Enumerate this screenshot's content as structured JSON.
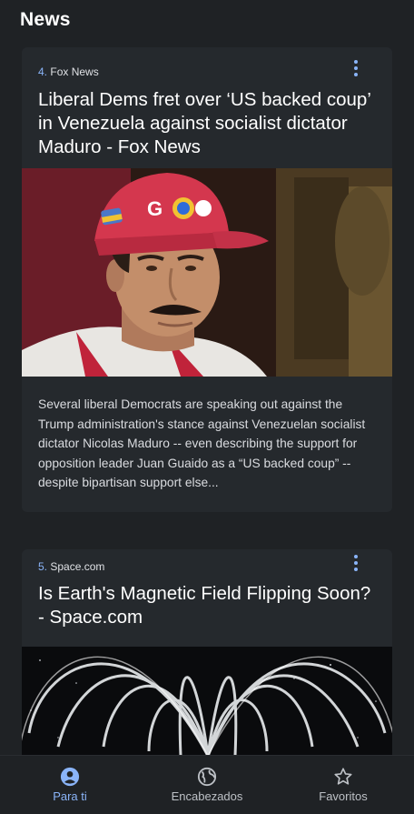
{
  "header": {
    "title": "News"
  },
  "articles": [
    {
      "rank": "4.",
      "source": "Fox News",
      "headline": "Liberal Dems fret over ‘US backed coup’ in Venezuela against socialist dictator Maduro - Fox News",
      "snippet": "Several liberal Democrats are speaking out against the Trump administration's stance against Venezuelan socialist dictator Nicolas Maduro -- even describing the support for opposition leader Juan Guaido as a “US backed coup” -- despite bipartisan support else...",
      "image": "man-red-cap-photo",
      "cap_text": "G"
    },
    {
      "rank": "5.",
      "source": "Space.com",
      "headline": "Is Earth's Magnetic Field Flipping Soon? - Space.com",
      "image": "magnetic-field-lines-illustration"
    }
  ],
  "bottom_nav": [
    {
      "label": "Para ti",
      "icon": "person-circle-icon",
      "active": true
    },
    {
      "label": "Encabezados",
      "icon": "globe-icon",
      "active": false
    },
    {
      "label": "Favoritos",
      "icon": "star-outline-icon",
      "active": false
    }
  ],
  "colors": {
    "background": "#1f2225",
    "card": "#25292d",
    "accent": "#8ab4f8",
    "text": "#ffffff"
  }
}
